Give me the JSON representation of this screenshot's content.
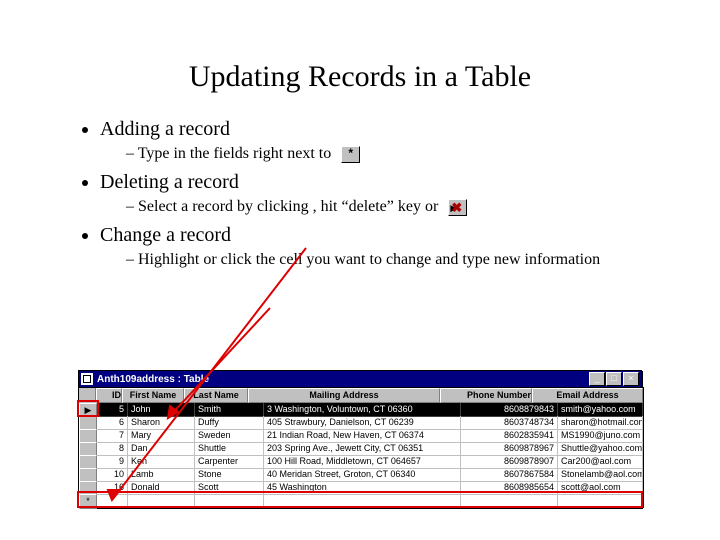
{
  "title": "Updating Records in a Table",
  "bullets": {
    "b1": "Adding a record",
    "b1_sub": "Type in the fields right next to",
    "b2": "Deleting a record",
    "b2_sub": "Select a record by clicking , hit “delete” key or",
    "b3": "Change a record",
    "b3_sub": "Highlight or click the cell you want to change and type new information"
  },
  "icons": {
    "asterisk": "*",
    "delete_arrow": "▶",
    "delete_x": "✖"
  },
  "window": {
    "title": "Anth109address : Table",
    "min": "_",
    "max": "□",
    "close": "×"
  },
  "columns": {
    "id": "ID",
    "first": "First Name",
    "last": "Last Name",
    "addr": "Mailing Address",
    "phone": "Phone Number",
    "email": "Email Address"
  },
  "rows": [
    {
      "marker": "▶",
      "id": "5",
      "first": "John",
      "last": "Smith",
      "addr": "3 Washington, Voluntown, CT 06360",
      "phone": "8608879843",
      "email": "smith@yahoo.com"
    },
    {
      "marker": "",
      "id": "6",
      "first": "Sharon",
      "last": "Duffy",
      "addr": "405 Strawbury, Danielson, CT 06239",
      "phone": "8603748734",
      "email": "sharon@hotmail.com"
    },
    {
      "marker": "",
      "id": "7",
      "first": "Mary",
      "last": "Sweden",
      "addr": "21 Indian Road, New Haven, CT 06374",
      "phone": "8602835941",
      "email": "MS1990@juno.com"
    },
    {
      "marker": "",
      "id": "8",
      "first": "Dan",
      "last": "Shuttle",
      "addr": "203 Spring Ave., Jewett City, CT 06351",
      "phone": "8609878967",
      "email": "Shuttle@yahoo.com"
    },
    {
      "marker": "",
      "id": "9",
      "first": "Ken",
      "last": "Carpenter",
      "addr": "100 Hill Road, Middletown, CT 064657",
      "phone": "8609878907",
      "email": "Car200@aol.com"
    },
    {
      "marker": "",
      "id": "10",
      "first": "Lamb",
      "last": "Stone",
      "addr": "40 Meridan Street, Groton, CT 06340",
      "phone": "8607867584",
      "email": "Stonelamb@aol.com"
    },
    {
      "marker": "",
      "id": "16",
      "first": "Donald",
      "last": "Scott",
      "addr": "45 Washington",
      "phone": "8608985654",
      "email": "scott@aol.com"
    }
  ],
  "newrow_marker": "*"
}
